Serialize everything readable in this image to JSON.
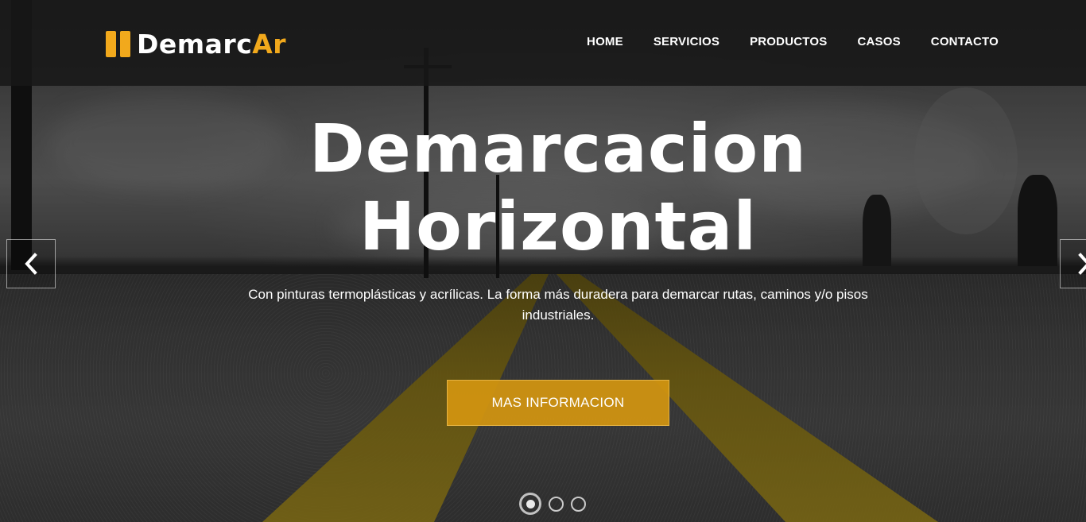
{
  "brand": {
    "name_main": "Demarc",
    "name_accent": "Ar",
    "accent_color": "#f2a91c"
  },
  "nav": {
    "items": [
      "HOME",
      "SERVICIOS",
      "PRODUCTOS",
      "CASOS",
      "CONTACTO"
    ]
  },
  "hero": {
    "title_line1": "Demarcacion",
    "title_line2": "Horizontal",
    "subtitle": "Con pinturas termoplásticas y acrílicas. La forma más duradera para demarcar rutas, caminos y/o pisos industriales.",
    "cta_label": "MAS INFORMACION",
    "cta_color": "#d49610"
  },
  "carousel": {
    "prev_icon": "chevron-left-icon",
    "next_icon": "chevron-right-icon",
    "slide_count": 3,
    "active_index": 0
  }
}
